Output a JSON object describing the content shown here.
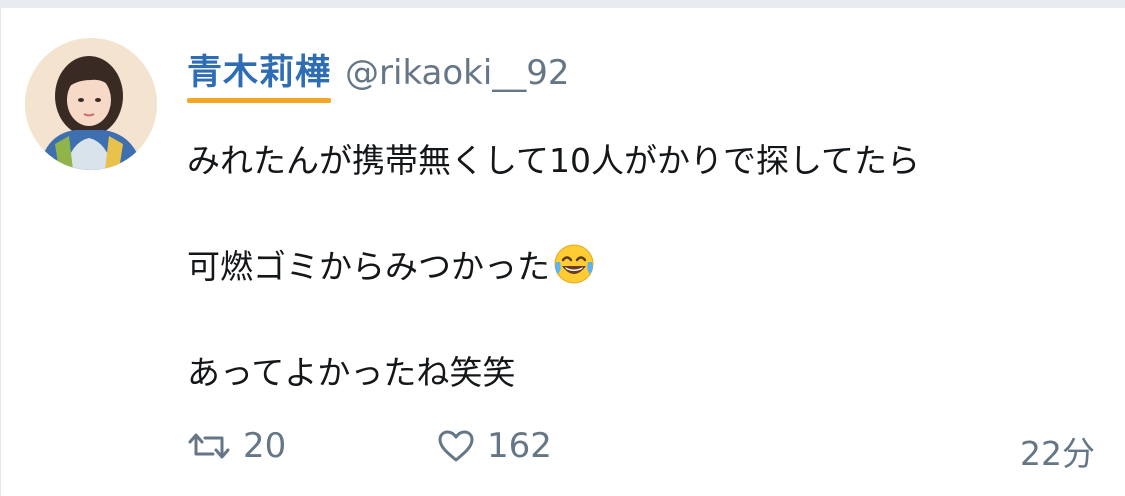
{
  "tweet": {
    "author_name": "青木莉樺",
    "author_handle": "@rikaoki__92",
    "lines": [
      "みれたんが携帯無くして10人がかりで探してたら",
      "可燃ゴミからみつかった",
      "あってよかったね笑笑"
    ],
    "emoji": "face-with-tears-of-joy",
    "retweet_count": "20",
    "like_count": "162",
    "timestamp": "22分"
  },
  "icons": {
    "retweet": "retweet-icon",
    "like": "heart-icon"
  },
  "colors": {
    "name": "#2e6db4",
    "name_underline": "#f5a623",
    "secondary_text": "#657786",
    "body_text": "#14171a"
  }
}
